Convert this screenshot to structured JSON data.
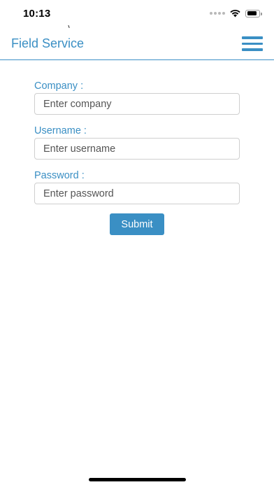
{
  "status_bar": {
    "time": "10:13",
    "battery_level": 0.9
  },
  "header": {
    "title": "Field Service"
  },
  "form": {
    "company": {
      "label": "Company :",
      "placeholder": "Enter company",
      "value": ""
    },
    "username": {
      "label": "Username :",
      "placeholder": "Enter username",
      "value": ""
    },
    "password": {
      "label": "Password :",
      "placeholder": "Enter password",
      "value": ""
    },
    "submit_label": "Submit"
  },
  "colors": {
    "accent": "#3a8fc4",
    "input_border": "#cfcfcf",
    "background": "#ffffff"
  }
}
